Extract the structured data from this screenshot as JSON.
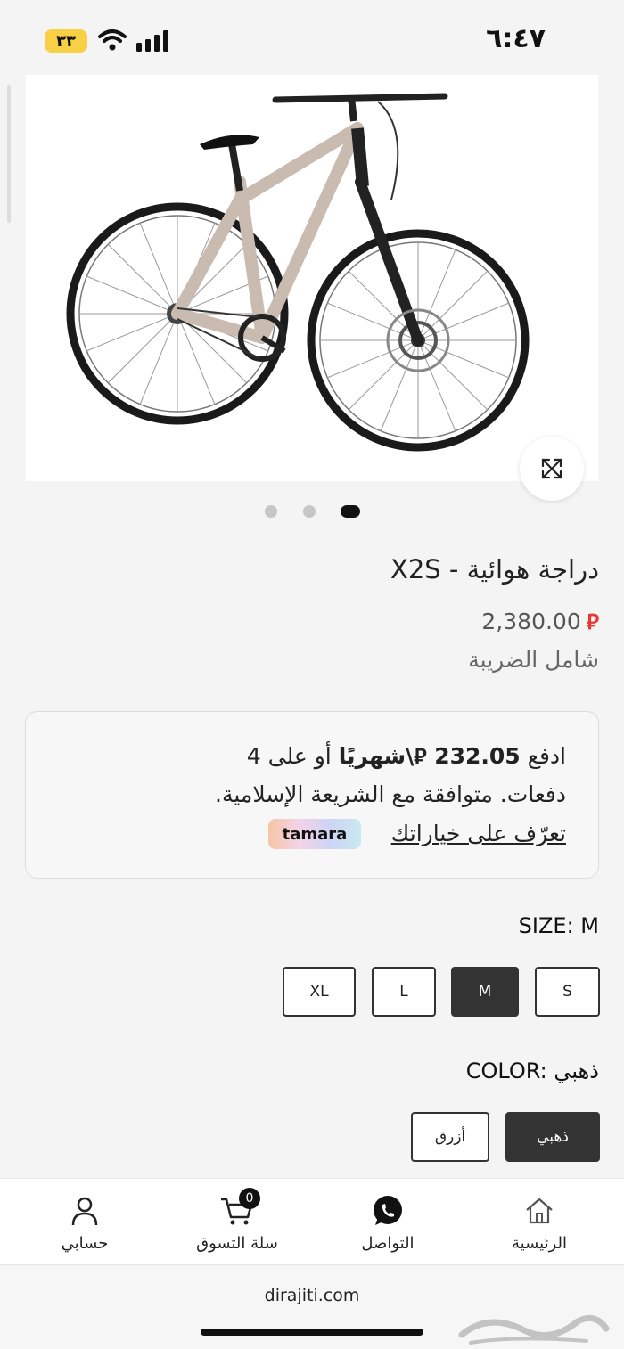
{
  "status_bar": {
    "time": "٦:٤٧",
    "battery": "٣٣"
  },
  "product": {
    "title": "دراجة هوائية - X2S",
    "price": "2,380.00",
    "currency_symbol": "⃁",
    "tax_note": "شامل الضريبة",
    "image_slides": 3,
    "active_slide": 2
  },
  "tamara": {
    "prefix": "ادفع",
    "amount": "232.05",
    "per_month": "\\شهريًا",
    "suffix": "أو على 4",
    "line2": "دفعات. متوافقة مع الشريعة الإسلامية.",
    "learn_more": "تعرّف على خياراتك",
    "brand": "tamara"
  },
  "size": {
    "label": "SIZE: M",
    "options": [
      "XL",
      "L",
      "M",
      "S"
    ],
    "selected": "M"
  },
  "color": {
    "label": "COLOR: ذهبي",
    "options": [
      "أزرق",
      "ذهبي"
    ],
    "selected": "ذهبي"
  },
  "bottom_nav": {
    "account": "حسابي",
    "cart": "سلة التسوق",
    "cart_count": "0",
    "contact": "التواصل",
    "home": "الرئيسية"
  },
  "browser": {
    "url": "dirajiti.com",
    "watermark": "حراج"
  },
  "colors": {
    "selected_bg": "#333333",
    "price_currency": "#e53935",
    "tamara_gradient": [
      "#f6c5a4",
      "#f4d3e8",
      "#cdd4f6",
      "#c9e9f0"
    ]
  }
}
